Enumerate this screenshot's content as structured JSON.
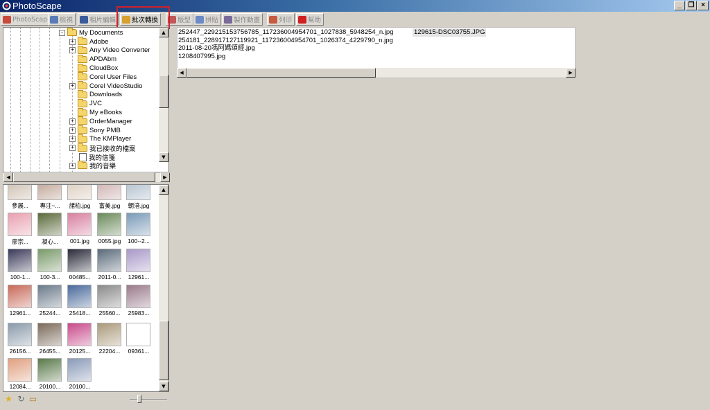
{
  "window": {
    "title": "PhotoScape",
    "controls": [
      "_",
      "❐",
      "×"
    ]
  },
  "tabs": [
    {
      "label": "PhotoScape",
      "active": false,
      "color": "#c84a3a"
    },
    {
      "label": "檢視",
      "active": false,
      "color": "#5a7ab8"
    },
    {
      "label": "相片編輯",
      "active": false,
      "color": "#3a5a9a"
    },
    {
      "label": "批次轉換",
      "active": true,
      "color": "#d8a030"
    },
    {
      "label": "版型",
      "active": false,
      "color": "#c05858"
    },
    {
      "label": "拼貼",
      "active": false,
      "color": "#6a8ac8"
    },
    {
      "label": "製作動畫",
      "active": false,
      "color": "#7a6a9a"
    },
    {
      "label": "列印",
      "active": false,
      "color": "#c85a40"
    },
    {
      "label": "幫助",
      "active": false,
      "color": "#d02020"
    }
  ],
  "folder_tree": {
    "root": {
      "label": "My Documents",
      "expander": "-"
    },
    "items": [
      {
        "label": "Adobe",
        "expander": "+",
        "icon": "folder"
      },
      {
        "label": "Any Video Converter",
        "expander": "+",
        "icon": "folder"
      },
      {
        "label": "APDAbm",
        "expander": "",
        "icon": "folder"
      },
      {
        "label": "CloudBox",
        "expander": "",
        "icon": "folder"
      },
      {
        "label": "Corel User Files",
        "expander": "",
        "icon": "folder"
      },
      {
        "label": "Corel VideoStudio",
        "expander": "+",
        "icon": "folder"
      },
      {
        "label": "Downloads",
        "expander": "",
        "icon": "folder"
      },
      {
        "label": "JVC",
        "expander": "",
        "icon": "folder"
      },
      {
        "label": "My eBooks",
        "expander": "",
        "icon": "folder"
      },
      {
        "label": "OrderManager",
        "expander": "+",
        "icon": "folder"
      },
      {
        "label": "Sony PMB",
        "expander": "+",
        "icon": "folder"
      },
      {
        "label": "The KMPlayer",
        "expander": "+",
        "icon": "folder"
      },
      {
        "label": "我已接收的檔案",
        "expander": "+",
        "icon": "folder"
      },
      {
        "label": "我的信箋",
        "expander": "",
        "icon": "doc"
      },
      {
        "label": "我的音樂",
        "expander": "+",
        "icon": "folder"
      }
    ]
  },
  "thumbnails": [
    {
      "caption": "參展...",
      "color": "#c8b8a8"
    },
    {
      "caption": "專注~...",
      "color": "#b89a8a"
    },
    {
      "caption": "諸柏.jpg",
      "color": "#d8c8b8"
    },
    {
      "caption": "富美.jpg",
      "color": "#c8a8a8"
    },
    {
      "caption": "朝湆.jpg",
      "color": "#a8b8c8"
    },
    {
      "caption": "廖宗...",
      "color": "#e8a0b0"
    },
    {
      "caption": "凝心...",
      "color": "#5a6a3a"
    },
    {
      "caption": "001.jpg",
      "color": "#d880a0"
    },
    {
      "caption": "0055.jpg",
      "color": "#6a8a5a"
    },
    {
      "caption": "100--2...",
      "color": "#7a9ab8"
    },
    {
      "caption": "100-1...",
      "color": "#3a3a5a"
    },
    {
      "caption": "100-3...",
      "color": "#7a9a6a"
    },
    {
      "caption": "00485...",
      "color": "#2a2a3a"
    },
    {
      "caption": "2011-0...",
      "color": "#5a6a7a"
    },
    {
      "caption": "12961...",
      "color": "#a898c8"
    },
    {
      "caption": "12961...",
      "color": "#c86a5a"
    },
    {
      "caption": "25244...",
      "color": "#6a7a8a"
    },
    {
      "caption": "25418...",
      "color": "#4a6a9a"
    },
    {
      "caption": "25560...",
      "color": "#8a8a8a"
    },
    {
      "caption": "25983...",
      "color": "#9a7a8a"
    },
    {
      "caption": "26156...",
      "color": "#8a9aaa"
    },
    {
      "caption": "26455...",
      "color": "#7a6a5a"
    },
    {
      "caption": "20125...",
      "color": "#c84a8a"
    },
    {
      "caption": "22204...",
      "color": "#aa9a7a"
    },
    {
      "caption": "09361...",
      "color": "#ffffff"
    },
    {
      "caption": "12084...",
      "color": "#e0a080"
    },
    {
      "caption": "20100...",
      "color": "#5a7a4a"
    },
    {
      "caption": "20100...",
      "color": "#8a9ab8"
    }
  ],
  "files": [
    "252447_229215153756785_117236004954701_1027838_5948254_n.jpg",
    "254181_228917127119921_117236004954701_1026374_4229790_n.jpg",
    "2011-08-20馮阿媽頌經.jpg",
    "1208407995.jpg"
  ],
  "selected_file": "129615-DSC03755.JPG",
  "bottom_icons": [
    {
      "name": "star-icon",
      "glyph": "★",
      "color": "#e0b020"
    },
    {
      "name": "refresh-icon",
      "glyph": "↻",
      "color": "#6a6a6a"
    },
    {
      "name": "folder-up-icon",
      "glyph": "▭",
      "color": "#b08030"
    }
  ]
}
